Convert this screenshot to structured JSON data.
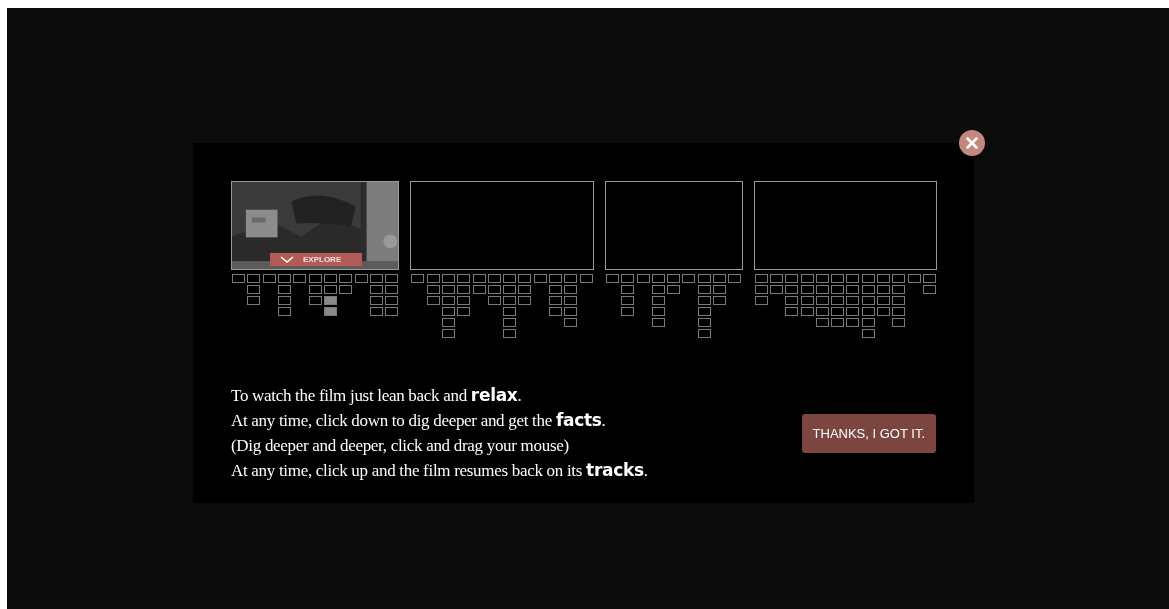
{
  "chapters": [
    {
      "selected": true,
      "explore_label": "EXPLORE",
      "columns": [
        [
          false
        ],
        [
          false,
          false,
          false
        ],
        [
          false
        ],
        [
          false,
          false,
          false,
          false
        ],
        [
          false
        ],
        [
          false,
          false,
          false
        ],
        [
          false,
          false,
          true,
          true
        ],
        [
          false,
          false
        ],
        [
          false
        ],
        [
          false,
          false,
          false,
          false
        ],
        [
          false,
          false,
          false,
          false
        ]
      ]
    },
    {
      "selected": false,
      "columns": [
        [
          false
        ],
        [
          false,
          false,
          false
        ],
        [
          false,
          false,
          false,
          false,
          false,
          false
        ],
        [
          false,
          false,
          false,
          false
        ],
        [
          false,
          false
        ],
        [
          false,
          false,
          false
        ],
        [
          false,
          false,
          false,
          false,
          false,
          false
        ],
        [
          false,
          false,
          false
        ],
        [
          false
        ],
        [
          false,
          false,
          false,
          false
        ],
        [
          false,
          false,
          false,
          false,
          false
        ],
        [
          false
        ]
      ]
    },
    {
      "selected": false,
      "columns": [
        [
          false
        ],
        [
          false,
          false,
          false,
          false
        ],
        [
          false
        ],
        [
          false,
          false,
          false,
          false,
          false
        ],
        [
          false,
          false
        ],
        [
          false
        ],
        [
          false,
          false,
          false,
          false,
          false,
          false
        ],
        [
          false,
          false,
          false
        ],
        [
          false
        ]
      ]
    },
    {
      "selected": false,
      "columns": [
        [
          false,
          false,
          false
        ],
        [
          false,
          false
        ],
        [
          false,
          false,
          false,
          false
        ],
        [
          false,
          false,
          false,
          false
        ],
        [
          false,
          false,
          false,
          false,
          false
        ],
        [
          false,
          false,
          false,
          false,
          false
        ],
        [
          false,
          false,
          false,
          false,
          false
        ],
        [
          false,
          false,
          false,
          false,
          false,
          false
        ],
        [
          false,
          false,
          false,
          false
        ],
        [
          false,
          false,
          false,
          false,
          false
        ],
        [
          false
        ],
        [
          false,
          false
        ]
      ]
    }
  ],
  "instructions": [
    "To watch the film just lean back and **relax**.",
    "At any time, click down to dig deeper and get the **facts**.",
    "(Dig deeper and deeper, click and drag your mouse)",
    "At any time, click up and the film resumes back on its **tracks**."
  ],
  "button": "THANKS, I GOT IT."
}
